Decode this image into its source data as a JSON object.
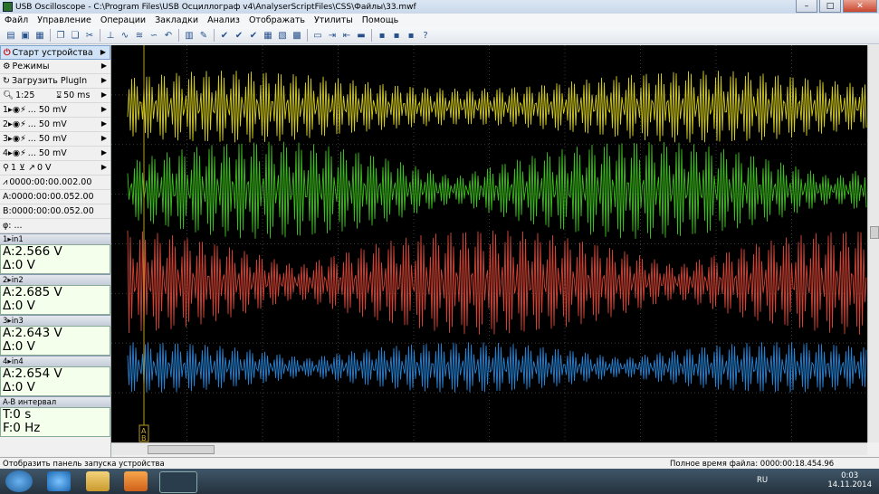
{
  "window": {
    "title": "USB Oscilloscope - C:\\Program Files\\USB Осциллограф v4\\AnalyserScriptFiles\\CSS\\Файлы\\33.mwf"
  },
  "window_buttons": [
    "–",
    "□",
    "✕"
  ],
  "menu": [
    "Файл",
    "Управление",
    "Операции",
    "Закладки",
    "Анализ",
    "Отображать",
    "Утилиты",
    "Помощь"
  ],
  "panel": {
    "start": "Старт устройства",
    "modes": "Режимы",
    "plugin": "Загрузить PlugIn",
    "zoom": "1:25",
    "timebase": "50 ms",
    "channels": [
      {
        "num": "1",
        "volts": "... 50 mV"
      },
      {
        "num": "2",
        "volts": "... 50 mV"
      },
      {
        "num": "3",
        "volts": "... 50 mV"
      },
      {
        "num": "4",
        "volts": "... 50 mV"
      }
    ],
    "trigger_ch": "1",
    "trigger_level": "0 V",
    "time_offset": "0000:00:00.002.00",
    "cursor_a": "A:0000:00:00.052.00",
    "cursor_b": "B:0000:00:00.052.00",
    "phi": "φ: ...",
    "readouts": [
      {
        "name": "in1",
        "a": "A:2.566 V",
        "d": "Δ:0 V"
      },
      {
        "name": "in2",
        "a": "A:2.685 V",
        "d": "Δ:0 V"
      },
      {
        "name": "in3",
        "a": "A:2.643 V",
        "d": "Δ:0 V"
      },
      {
        "name": "in4",
        "a": "A:2.654 V",
        "d": "Δ:0 V"
      }
    ],
    "interval_title": "A-B интервал",
    "interval_t": "T:0 s",
    "interval_f": "F:0 Hz"
  },
  "scope": {
    "traces": [
      {
        "channel": "in1",
        "color": "#e8e020"
      },
      {
        "channel": "in2",
        "color": "#44d020"
      },
      {
        "channel": "in3",
        "color": "#e84a3a"
      },
      {
        "channel": "in4",
        "color": "#2a8fe8"
      }
    ],
    "cursor_labels": [
      "A",
      "B"
    ]
  },
  "status": {
    "left": "Отобразить панель запуска устройства",
    "right": "Полное время файла: 0000:00:18.454.96"
  },
  "taskbar": {
    "lang": "RU",
    "time": "0:03",
    "date": "14.11.2014"
  }
}
